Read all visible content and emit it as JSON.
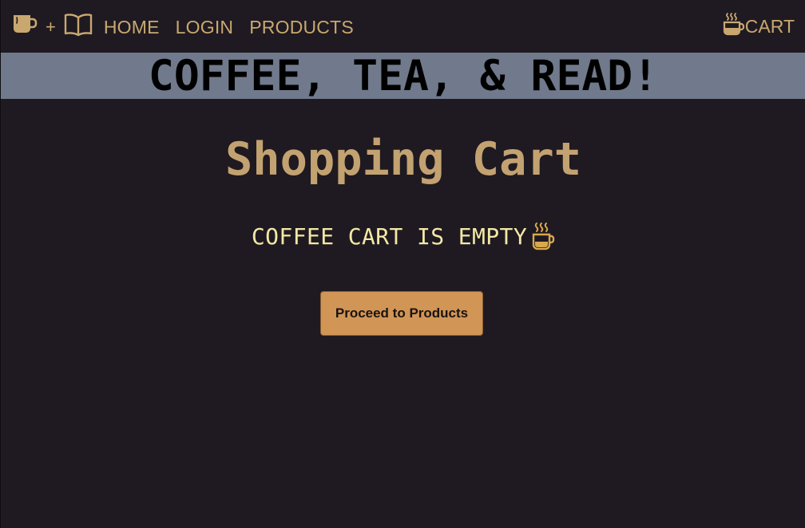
{
  "nav": {
    "logo_plus": "+",
    "links": [
      {
        "label": "HOME"
      },
      {
        "label": "LOGIN"
      },
      {
        "label": "PRODUCTS"
      }
    ],
    "cart_label": "CART"
  },
  "banner": {
    "title": "COFFEE, TEA, & READ!"
  },
  "main": {
    "title": "Shopping Cart",
    "empty_message": "COFFEE CART IS EMPTY",
    "proceed_button_label": "Proceed to Products"
  },
  "icons": {
    "logo_cup": "coffee-mug-icon",
    "logo_book": "open-book-icon",
    "cart": "coffee-cup-icon",
    "empty_cart": "coffee-cup-icon"
  },
  "colors": {
    "background": "#1f1a21",
    "nav_text": "#c9a870",
    "banner_bg": "#707a8c",
    "title_text": "#c3a271",
    "empty_text": "#f3e8a6",
    "button_bg": "#d19556"
  }
}
